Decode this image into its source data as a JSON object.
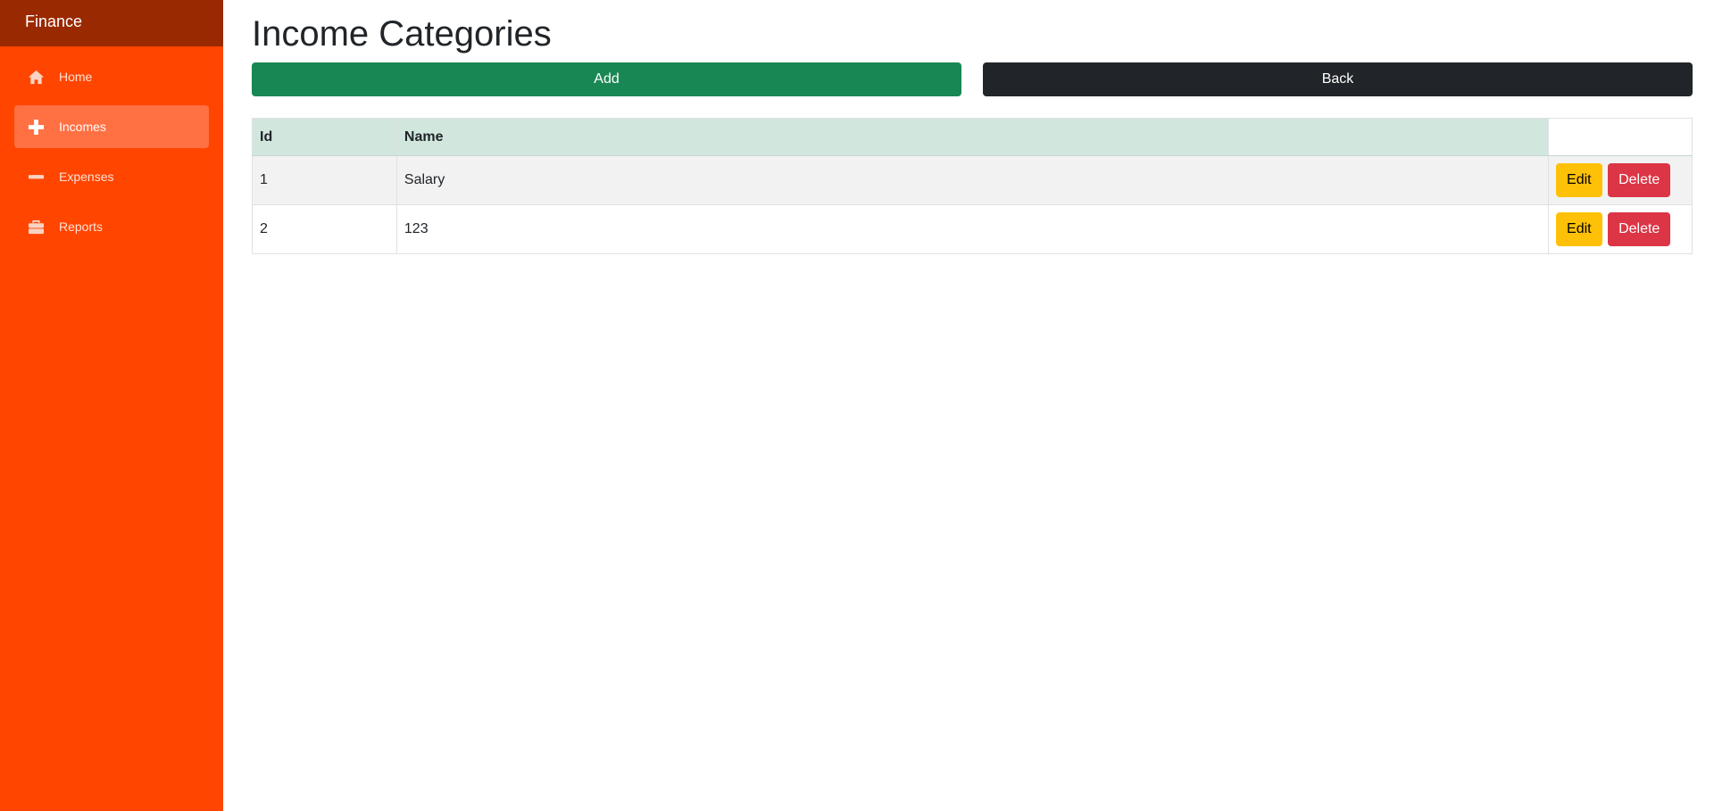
{
  "app": {
    "brand": "Finance"
  },
  "sidebar": {
    "items": [
      {
        "label": "Home",
        "icon": "home-icon",
        "active": false
      },
      {
        "label": "Incomes",
        "icon": "plus-icon",
        "active": true
      },
      {
        "label": "Expenses",
        "icon": "minus-icon",
        "active": false
      },
      {
        "label": "Reports",
        "icon": "briefcase-icon",
        "active": false
      }
    ]
  },
  "main": {
    "title": "Income Categories",
    "add_label": "Add",
    "back_label": "Back",
    "table": {
      "columns": [
        "Id",
        "Name"
      ],
      "rows": [
        {
          "id": "1",
          "name": "Salary",
          "edit_label": "Edit",
          "delete_label": "Delete"
        },
        {
          "id": "2",
          "name": "123",
          "edit_label": "Edit",
          "delete_label": "Delete"
        }
      ]
    }
  },
  "colors": {
    "sidebar": "#ff4500",
    "brand_bar": "#992900",
    "active_item": "#ff7043",
    "add_button": "#198754",
    "back_button": "#212529",
    "edit_button": "#ffc107",
    "delete_button": "#dc3545",
    "header_row": "#d1e7dd"
  }
}
